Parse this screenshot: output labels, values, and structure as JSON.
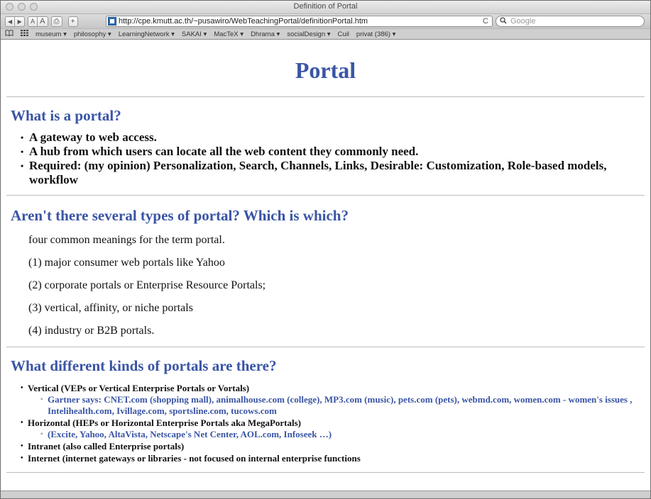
{
  "window": {
    "title": "Definition of Portal"
  },
  "toolbar": {
    "back": "◀",
    "forward": "▶",
    "smaller_text": "A",
    "bigger_text": "A",
    "print": "⎙",
    "add_bookmark": "+",
    "url": "http://cpe.kmutt.ac.th/~pusawiro/WebTeachingPortal/definitionPortal.htm",
    "reload": "C",
    "search_placeholder": "Google"
  },
  "bookmarks": {
    "items": [
      "museum ▾",
      "philosophy ▾",
      "LearningNetwork ▾",
      "SAKAI ▾",
      "MacTeX ▾",
      "Dhrama ▾",
      "socialDesign ▾",
      "Cuil",
      "privat (386) ▾"
    ]
  },
  "page": {
    "title": "Portal",
    "sections": [
      {
        "heading": "What is a portal?",
        "items": [
          "A gateway to web access.",
          "A hub from which users can locate all the web content they commonly need.",
          "Required: (my opinion) Personalization, Search, Channels, Links, Desirable: Customization, Role-based models, workflow"
        ]
      },
      {
        "heading": "Aren't there several types of portal? Which is which?",
        "paragraphs": [
          "four common meanings for the term portal.",
          "(1) major consumer web portals like Yahoo",
          "(2) corporate portals or Enterprise Resource Portals;",
          "(3) vertical, affinity, or niche portals",
          "(4) industry or B2B portals."
        ]
      },
      {
        "heading": "What different kinds of portals are there?",
        "items": [
          {
            "text": "Vertical (VEPs or Vertical Enterprise Portals or Vortals)",
            "sub": "Gartner says: CNET.com (shopping mall), animalhouse.com (college), MP3.com (music), pets.com (pets), webmd.com, women.com - women's issues , Intelihealth.com, Ivillage.com, sportsline.com, tucows.com"
          },
          {
            "text": "Horizontal (HEPs or Horizontal Enterprise Portals aka MegaPortals)",
            "sub": "(Excite, Yahoo, AltaVista, Netscape's Net Center, AOL.com, Infoseek …)"
          },
          {
            "text": "Intranet (also called Enterprise portals)"
          },
          {
            "text": "Internet (internet gateways or libraries - not focused on internal enterprise functions"
          }
        ]
      }
    ]
  }
}
